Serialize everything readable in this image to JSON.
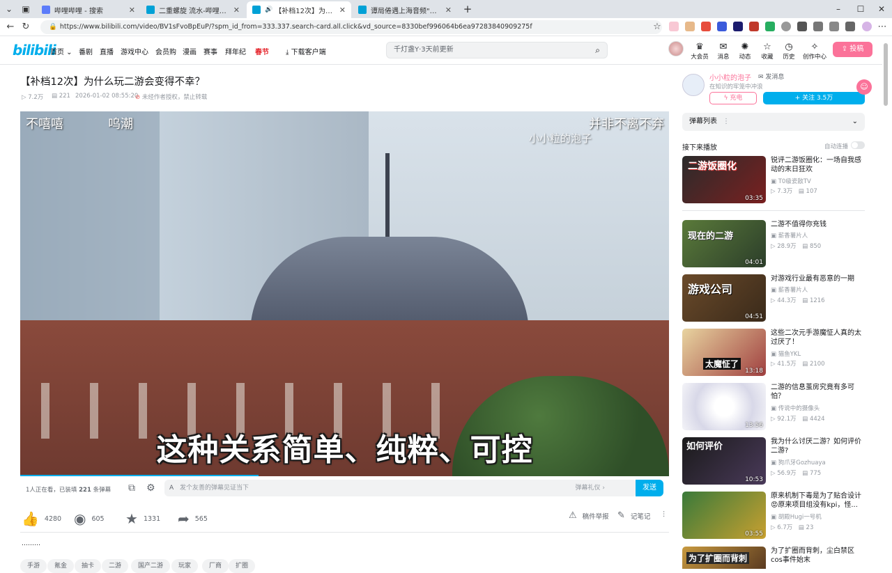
{
  "browser": {
    "tabs": [
      {
        "title": "哔哩哔哩 - 搜索",
        "active": false
      },
      {
        "title": "二重螺旋 流水-哔哩哔哩_bilibili",
        "active": false
      },
      {
        "title": "【补档12次】为什么玩二游会变",
        "active": true
      },
      {
        "title": "谭局倦遇上海音频\"背刺\"12亿流水",
        "active": false
      }
    ],
    "url": "https://www.bilibili.com/video/BV1sFvoBpEuP/?spm_id_from=333.337.search-card.all.click&vd_source=8330bef996064b6ea97283840909275f",
    "new_tab": "+",
    "window_controls": [
      "–",
      "☐",
      "✕"
    ]
  },
  "header": {
    "logo": "bilibili",
    "nav": [
      "首页",
      "番剧",
      "直播",
      "游戏中心",
      "会员购",
      "漫画",
      "赛事",
      "拜年纪",
      "春节",
      "下载客户端"
    ],
    "search_placeholder": "千灯盏Y·3天前更新",
    "icons": [
      "大会员",
      "消息",
      "动态",
      "收藏",
      "历史",
      "创作中心"
    ],
    "upload": "投稿"
  },
  "video": {
    "title": "【补档12次】为什么玩二游会变得不幸？",
    "views": "7.2万",
    "danmaku_count": "221",
    "date": "2026-01-02 08:55:20",
    "copyright": "未经作者授权，禁止转载",
    "subtitle": "这种关系简单、纯粹、可控",
    "danmu": [
      "不嘻嘻",
      "呜潮",
      "并非不离不弃",
      "小小粒的泡子"
    ],
    "watching": "1人正在看，已装填",
    "watching_count": "221",
    "watching_suffix": "条弹幕",
    "danmu_placeholder": "发个友善的弹幕见证当下",
    "danmu_etiquette": "弹幕礼仪 ›",
    "send": "发送",
    "progress": 0.367
  },
  "toolbar": {
    "like": "4280",
    "coin": "605",
    "favorite": "1331",
    "share": "565",
    "report": "稿件举报",
    "notes": "记笔记",
    "more": "⋮"
  },
  "description": "………",
  "tags": [
    "手游",
    "氪金",
    "抽卡",
    "二游",
    "国产二游",
    "玩家",
    "厂商",
    "扩圈"
  ],
  "uploader": {
    "name": "小小粒的泡子",
    "message": "发消息",
    "desc": "在知识的牢笼中冲浪",
    "charge": "充电",
    "follow": "+ 关注 3.5万"
  },
  "sidebar": {
    "danmaku_list": "弹幕列表",
    "up_next": "接下来播放",
    "autoplay": "自动连播",
    "videos": [
      {
        "title": "锐评二游饭圈化：一场自我感动的末日狂欢",
        "uploader": "T0级瓷敌TV",
        "views": "7.3万",
        "danmaku": "107",
        "duration": "03:35",
        "thumb_text": "二游饭圈化"
      },
      {
        "title": "二游不值得你充钱",
        "uploader": "薪香薯片人",
        "views": "28.9万",
        "danmaku": "850",
        "duration": "04:01",
        "thumb_text": "现在的二游"
      },
      {
        "title": "对游戏行业最有恶意的一期",
        "uploader": "薪香薯片人",
        "views": "44.3万",
        "danmaku": "1216",
        "duration": "04:51",
        "thumb_text": "游戏公司"
      },
      {
        "title": "这些二次元手游魔怔人真的太过厌了！",
        "uploader": "猫鱼YKL",
        "views": "41.5万",
        "danmaku": "2100",
        "duration": "13:18",
        "thumb_text": "太魔怔了"
      },
      {
        "title": "二游的信息茧房究竟有多可怕？",
        "uploader": "传说中的摄像头",
        "views": "92.1万",
        "danmaku": "4424",
        "duration": "13:56",
        "thumb_text": ""
      },
      {
        "title": "我为什么讨厌二游？如何评价二游?",
        "uploader": "狗爪牙Gozhuaya",
        "views": "56.9万",
        "danmaku": "775",
        "duration": "10:53",
        "thumb_text": "如何评价"
      },
      {
        "title": "原来机制下毒是为了贴合设计😡原来项目组没有kpi，怪...",
        "uploader": "胡殿Hugi一号机",
        "views": "6.7万",
        "danmaku": "23",
        "duration": "03:55",
        "thumb_text": ""
      },
      {
        "title": "为了扩圈而背刺，尘白禁区cos事件始末",
        "uploader": "",
        "views": "",
        "danmaku": "",
        "duration": "",
        "thumb_text": "为了扩圈而背刺"
      }
    ]
  },
  "colors": {
    "accent": "#00aeec",
    "pink": "#fb7299"
  }
}
